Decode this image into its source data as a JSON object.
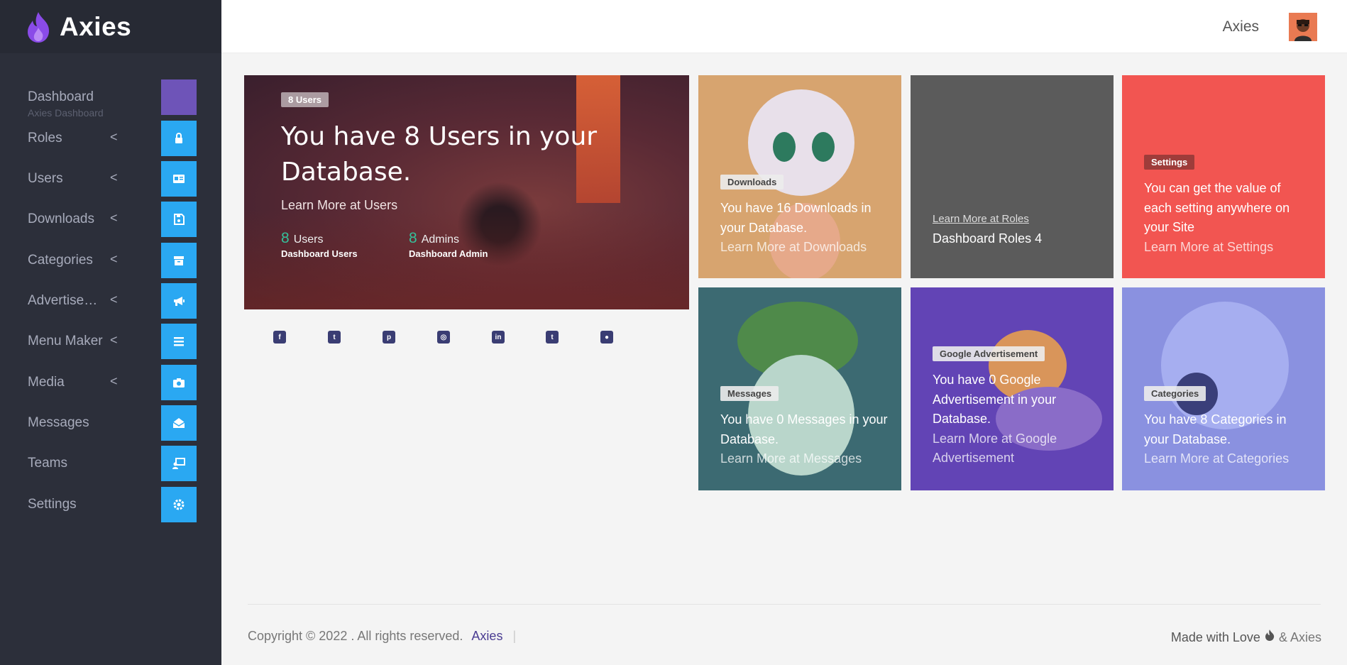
{
  "brand": {
    "name": "Axies"
  },
  "topbar": {
    "user_name": "Axies"
  },
  "sidebar": {
    "dashboard": {
      "label": "Dashboard",
      "sub": "Axies Dashboard"
    },
    "items": [
      {
        "label": "Roles",
        "icon": "lock-icon"
      },
      {
        "label": "Users",
        "icon": "id-card-icon"
      },
      {
        "label": "Downloads",
        "icon": "save-icon"
      },
      {
        "label": "Categories",
        "icon": "archive-icon"
      },
      {
        "label": "Advertise…",
        "icon": "megaphone-icon"
      },
      {
        "label": "Menu Maker",
        "icon": "list-icon"
      },
      {
        "label": "Media",
        "icon": "camera-icon"
      },
      {
        "label": "Messages",
        "icon": "envelope-open-icon"
      },
      {
        "label": "Teams",
        "icon": "chalkboard-user-icon"
      },
      {
        "label": "Settings",
        "icon": "gear-icon"
      }
    ],
    "chevron": "<"
  },
  "hero": {
    "badge": "8 Users",
    "title": "You have 8 Users in your Database.",
    "link": "Learn More at Users",
    "stats": [
      {
        "value": "8",
        "label": "Users",
        "caption": "Dashboard Users"
      },
      {
        "value": "8",
        "label": "Admins",
        "caption": "Dashboard Admin"
      }
    ]
  },
  "social": [
    "facebook-icon",
    "twitter-icon",
    "pinterest-icon",
    "instagram-icon",
    "linkedin-icon",
    "tumblr-icon",
    "github-icon"
  ],
  "cards": {
    "downloads": {
      "badge": "Downloads",
      "text": "You have 16 Downloads in your Database.",
      "link": "Learn More at Downloads",
      "color": "#d7a46f"
    },
    "roles": {
      "link": "Learn More at Roles",
      "text": "Dashboard Roles 4",
      "color": "#5b5b5b"
    },
    "settings": {
      "badge": "Settings",
      "text": "You can get the value of each setting anywhere on your Site",
      "link": "Learn More at Settings",
      "color": "#f25551"
    },
    "messages": {
      "badge": "Messages",
      "text": "You have 0 Messages in your Database.",
      "link": "Learn More at Messages",
      "color": "#3c6a72"
    },
    "google": {
      "badge": "Google Advertisement",
      "text": "You have 0 Google Advertisement in your Database.",
      "link": "Learn More at Google Advertisement",
      "color": "#6244b5"
    },
    "categories": {
      "badge": "Categories",
      "text": "You have 8 Categories in your Database.",
      "link": "Learn More at Categories",
      "color": "#8a91e0"
    }
  },
  "footer": {
    "copyright": "Copyright © 2022 . All rights reserved.",
    "brand": "Axies",
    "separator": "|",
    "made_with": "Made with Love",
    "amp_brand": "& Axies"
  }
}
